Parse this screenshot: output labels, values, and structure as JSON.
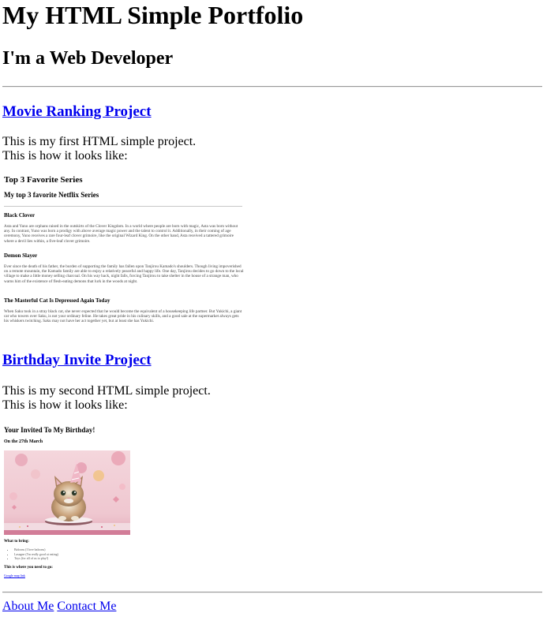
{
  "header": {
    "title": "My HTML Simple Portfolio",
    "subtitle": "I'm a Web Developer"
  },
  "projects": [
    {
      "title": "Movie Ranking Project",
      "desc_line1": "This is my first HTML simple project.",
      "desc_line2": "This is how it looks like:",
      "screenshot": {
        "heading": "Top 3 Favorite Series",
        "subheading": "My top 3 favorite Netflix Series",
        "items": [
          {
            "title": "Black Clover",
            "text": "Asta and Yuno are orphans raised in the outskirts of the Clover Kingdom. In a world where people are born with magic, Asta was born without any. In contrast, Yuno was born a prodigy with above average magic power and the talent to control it. Additionally, in their coming of age ceremony, Yuno receives a rare four-leaf clover grimoire, like the original Wizard King. On the other hand, Asta received a tattered grimoire where a devil lies within, a five-leaf clover grimoire."
          },
          {
            "title": "Demon Slayer",
            "text": "Ever since the death of his father, the burden of supporting the family has fallen upon Tanjirou Kamado's shoulders. Though living impoverished on a remote mountain, the Kamado family are able to enjoy a relatively peaceful and happy life. One day, Tanjirou decides to go down to the local village to make a little money selling charcoal. On his way back, night falls, forcing Tanjirou to take shelter in the house of a strange man, who warns him of the existence of flesh-eating demons that lurk in the woods at night."
          },
          {
            "title": "The Masterful Cat Is Depressed Again Today",
            "text": "When Saku took in a stray black cat, she never expected that he would become the equivalent of a housekeeping life partner. But Yukichi, a giant cat who towers over Saku, is not your ordinary feline. He takes great pride in his culinary skills, and a good sale at the supermarket always gets his whiskers twitching. Saku may not have her act together yet, but at least she has Yukichi."
          }
        ]
      }
    },
    {
      "title": "Birthday Invite Project",
      "desc_line1": "This is my second HTML simple project.",
      "desc_line2": "This is how it looks like:",
      "screenshot": {
        "heading": "Your Invited To My Birthday!",
        "subheading": "On the 27th March",
        "bring_label": "What to bring:",
        "bring_items": [
          "Baloons (I love baloons)",
          "Lasagne (I'm really good at eating)",
          "Toys (for all of us to play!)"
        ],
        "location_label": "This is where you need to go:",
        "location_link": "Google map link"
      }
    }
  ],
  "footer": {
    "about": "About Me",
    "contact": "Contact Me"
  },
  "colors": {
    "link": "#0000ee",
    "rule": "#9a9a9a"
  }
}
